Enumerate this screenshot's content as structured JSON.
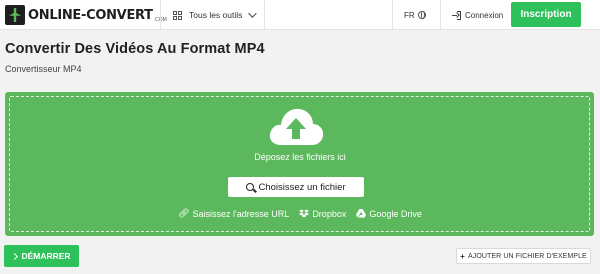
{
  "header": {
    "logo_text": "ONLINE-CONVERT",
    "logo_suffix": ".COM",
    "tools_label": "Tous les outils",
    "language": "FR",
    "login_label": "Connexion",
    "signup_label": "Inscription"
  },
  "page": {
    "title": "Convertir Des Vidéos Au Format MP4",
    "subtitle": "Convertisseur MP4"
  },
  "dropzone": {
    "drop_label": "Déposez les fichiers ici",
    "choose_label": "Choisissez un fichier",
    "sources": [
      {
        "label": "Saisissez l'adresse URL",
        "icon": "link-icon"
      },
      {
        "label": "Dropbox",
        "icon": "dropbox-icon"
      },
      {
        "label": "Google Drive",
        "icon": "google-drive-icon"
      }
    ]
  },
  "actions": {
    "start_label": "DÉMARRER",
    "add_example_label": "AJOUTER UN FICHIER D'EXEMPLE"
  },
  "colors": {
    "accent_green": "#2ec05a",
    "dropzone_green": "#5cb85c"
  }
}
